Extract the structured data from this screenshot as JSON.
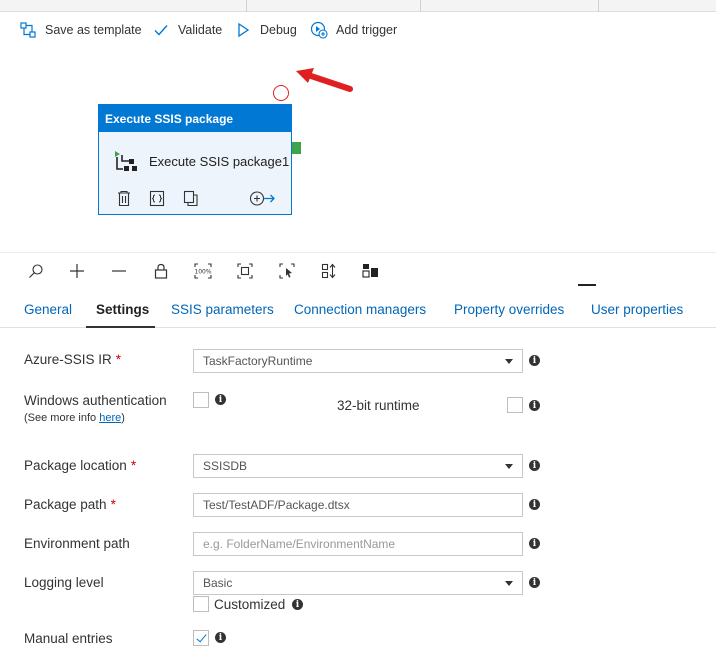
{
  "toolbar": {
    "save_template": "Save as template",
    "validate": "Validate",
    "debug": "Debug",
    "add_trigger": "Add trigger"
  },
  "activity": {
    "header": "Execute SSIS package",
    "name": "Execute SSIS package1"
  },
  "tabs": [
    {
      "label": "General",
      "active": false
    },
    {
      "label": "Settings",
      "active": true
    },
    {
      "label": "SSIS parameters",
      "active": false
    },
    {
      "label": "Connection managers",
      "active": false
    },
    {
      "label": "Property overrides",
      "active": false
    },
    {
      "label": "User properties",
      "active": false
    }
  ],
  "form": {
    "ir_label": "Azure-SSIS IR",
    "ir_value": "TaskFactoryRuntime",
    "winauth_label": "Windows authentication",
    "winauth_sub_prefix": "(See more info ",
    "winauth_sub_link": "here",
    "winauth_sub_suffix": ")",
    "winauth_checked": false,
    "runtime32_label": "32-bit runtime",
    "runtime32_checked": false,
    "pkgloc_label": "Package location",
    "pkgloc_value": "SSISDB",
    "pkgpath_label": "Package path",
    "pkgpath_value": "Test/TestADF/Package.dtsx",
    "envpath_label": "Environment path",
    "envpath_placeholder": "e.g. FolderName/EnvironmentName",
    "logging_label": "Logging level",
    "logging_value": "Basic",
    "customized_label": "Customized",
    "customized_checked": false,
    "manual_label": "Manual entries",
    "manual_checked": true,
    "required_marker": "*",
    "info_glyph": "i"
  },
  "colors": {
    "accent": "#0078d4",
    "link": "#0066b8",
    "required": "#cc0000",
    "annotation_arrow": "#e02020",
    "output_port": "#3ea34a"
  }
}
